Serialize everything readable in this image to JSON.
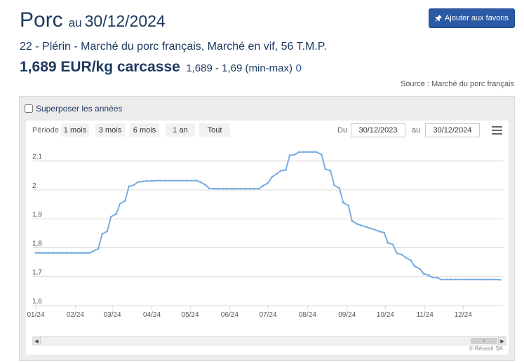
{
  "header": {
    "product": "Porc",
    "date_prefix": "au",
    "date": "30/12/2024",
    "favorite_button": "Ajouter aux favoris",
    "subtitle": "22 - Plérin - Marché du porc français, Marché en vif, 56 T.M.P.",
    "price": "1,689 EUR/kg carcasse",
    "price_range": "1,689 - 1,69 (min-max)",
    "price_extra": "0",
    "source": "Source : Marché du porc français"
  },
  "controls": {
    "overlay_label": "Superposer les années",
    "overlay_checked": false,
    "period_label": "Période",
    "range_buttons": [
      "1 mois",
      "3 mois",
      "6 mois",
      "1 an",
      "Tout"
    ],
    "from_label": "Du",
    "from_date": "30/12/2023",
    "to_label": "au",
    "to_date": "30/12/2024",
    "credit": "© Réussir SA",
    "scroll_thumb_glyph": "≡"
  },
  "colors": {
    "title": "#1f3a60",
    "button": "#2a5aa5",
    "line": "#7aaee0",
    "grid": "#d9d9d9"
  },
  "chart_data": {
    "type": "line",
    "title": "",
    "xlabel": "",
    "ylabel": "",
    "ylim": [
      1.6,
      2.1
    ],
    "y_ticks": [
      "1,6",
      "1,7",
      "1,8",
      "1,9",
      "2",
      "2,1"
    ],
    "x_ticks": [
      "01/24",
      "02/24",
      "03/24",
      "04/24",
      "05/24",
      "06/24",
      "07/24",
      "08/24",
      "09/24",
      "10/24",
      "11/24",
      "12/24"
    ],
    "grid": true,
    "series": [
      {
        "name": "",
        "x": [
          "2024-01-01",
          "2024-01-04",
          "2024-01-08",
          "2024-01-11",
          "2024-01-15",
          "2024-01-18",
          "2024-01-22",
          "2024-01-25",
          "2024-01-29",
          "2024-02-01",
          "2024-02-05",
          "2024-02-08",
          "2024-02-12",
          "2024-02-15",
          "2024-02-19",
          "2024-02-22",
          "2024-02-26",
          "2024-02-29",
          "2024-03-04",
          "2024-03-07",
          "2024-03-11",
          "2024-03-14",
          "2024-03-18",
          "2024-03-21",
          "2024-03-25",
          "2024-03-28",
          "2024-04-01",
          "2024-04-04",
          "2024-04-08",
          "2024-04-11",
          "2024-04-15",
          "2024-04-18",
          "2024-04-22",
          "2024-04-25",
          "2024-04-29",
          "2024-05-02",
          "2024-05-06",
          "2024-05-09",
          "2024-05-13",
          "2024-05-16",
          "2024-05-20",
          "2024-05-23",
          "2024-05-27",
          "2024-05-30",
          "2024-06-03",
          "2024-06-06",
          "2024-06-10",
          "2024-06-13",
          "2024-06-17",
          "2024-06-20",
          "2024-06-24",
          "2024-06-27",
          "2024-07-01",
          "2024-07-04",
          "2024-07-08",
          "2024-07-11",
          "2024-07-15",
          "2024-07-18",
          "2024-07-22",
          "2024-07-25",
          "2024-07-29",
          "2024-08-01",
          "2024-08-05",
          "2024-08-08",
          "2024-08-12",
          "2024-08-15",
          "2024-08-19",
          "2024-08-22",
          "2024-08-26",
          "2024-08-29",
          "2024-09-02",
          "2024-09-05",
          "2024-09-09",
          "2024-09-12",
          "2024-09-16",
          "2024-09-19",
          "2024-09-23",
          "2024-09-26",
          "2024-09-30",
          "2024-10-03",
          "2024-10-07",
          "2024-10-10",
          "2024-10-14",
          "2024-10-17",
          "2024-10-21",
          "2024-10-24",
          "2024-10-28",
          "2024-10-31",
          "2024-11-04",
          "2024-11-07",
          "2024-11-11",
          "2024-11-14",
          "2024-11-18",
          "2024-11-21",
          "2024-11-25",
          "2024-11-28",
          "2024-12-02",
          "2024-12-05",
          "2024-12-09",
          "2024-12-12",
          "2024-12-16",
          "2024-12-19",
          "2024-12-23",
          "2024-12-26",
          "2024-12-30"
        ],
        "values": [
          1.782,
          1.782,
          1.782,
          1.782,
          1.782,
          1.782,
          1.782,
          1.782,
          1.782,
          1.782,
          1.782,
          1.782,
          1.782,
          1.787,
          1.797,
          1.847,
          1.857,
          1.907,
          1.917,
          1.952,
          1.962,
          2.012,
          2.017,
          2.027,
          2.029,
          2.031,
          2.031,
          2.032,
          2.032,
          2.032,
          2.032,
          2.032,
          2.032,
          2.032,
          2.032,
          2.032,
          2.032,
          2.027,
          2.017,
          2.005,
          2.004,
          2.004,
          2.004,
          2.004,
          2.004,
          2.004,
          2.004,
          2.004,
          2.004,
          2.004,
          2.004,
          2.014,
          2.024,
          2.044,
          2.056,
          2.066,
          2.069,
          2.119,
          2.122,
          2.13,
          2.131,
          2.131,
          2.131,
          2.131,
          2.122,
          2.072,
          2.066,
          2.016,
          2.006,
          1.956,
          1.946,
          1.892,
          1.882,
          1.877,
          1.872,
          1.867,
          1.862,
          1.857,
          1.852,
          1.817,
          1.811,
          1.781,
          1.776,
          1.766,
          1.756,
          1.736,
          1.727,
          1.71,
          1.705,
          1.697,
          1.696,
          1.69,
          1.69,
          1.69,
          1.69,
          1.69,
          1.69,
          1.69,
          1.69,
          1.69,
          1.69,
          1.69,
          1.69,
          1.69,
          1.689
        ]
      }
    ]
  }
}
